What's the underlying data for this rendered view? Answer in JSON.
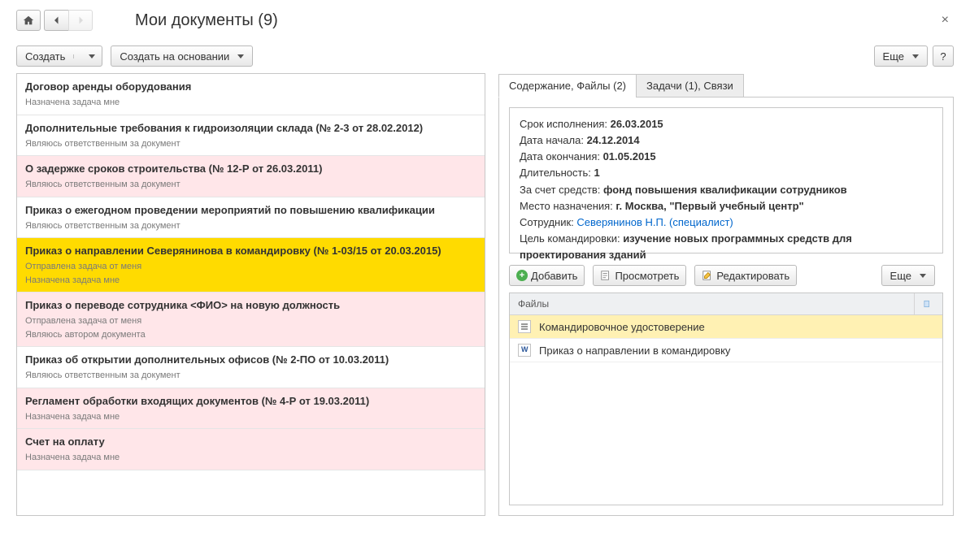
{
  "header": {
    "title": "Мои документы (9)"
  },
  "toolbar": {
    "create": "Создать",
    "create_based_on": "Создать на основании",
    "more": "Еще",
    "help": "?"
  },
  "documents": [
    {
      "title": "Договор аренды оборудования",
      "sub": "Назначена задача мне",
      "style": "white"
    },
    {
      "title": "Дополнительные требования к гидроизоляции склада (№ 2-3 от 28.02.2012)",
      "sub": "Являюсь ответственным за документ",
      "style": "white"
    },
    {
      "title": "О задержке сроков строительства (№ 12-Р от 26.03.2011)",
      "sub": "Являюсь ответственным за документ",
      "style": "pink"
    },
    {
      "title": "Приказ о ежегодном проведении мероприятий по повышению квалификации",
      "sub": "Являюсь ответственным за документ",
      "style": "white"
    },
    {
      "title": "Приказ о направлении Северянинова в командировку (№ 1-03/15 от 20.03.2015)",
      "sub": "Отправлена задача от меня\nНазначена задача мне",
      "style": "sel"
    },
    {
      "title": "Приказ о переводе сотрудника <ФИО> на новую должность",
      "sub": "Отправлена задача от меня\nЯвляюсь автором документа",
      "style": "pink"
    },
    {
      "title": "Приказ об открытии дополнительных офисов (№ 2-ПО от 10.03.2011)",
      "sub": "Являюсь ответственным за документ",
      "style": "white"
    },
    {
      "title": "Регламент обработки входящих документов (№ 4-Р от 19.03.2011)",
      "sub": "Назначена задача мне",
      "style": "pink"
    },
    {
      "title": "Счет на оплату",
      "sub": "Назначена задача мне",
      "style": "pink"
    }
  ],
  "tabs": {
    "tab1": "Содержание, Файлы (2)",
    "tab2": "Задачи (1), Связи"
  },
  "details": {
    "due_label": "Срок исполнения: ",
    "due": "26.03.2015",
    "start_label": "Дата начала: ",
    "start": "24.12.2014",
    "end_label": "Дата окончания: ",
    "end": "01.05.2015",
    "duration_label": "Длительность: ",
    "duration": "1",
    "funds_label": "За счет средств: ",
    "funds": "фонд повышения квалификации сотрудников",
    "place_label": "Место назначения: ",
    "place": "г. Москва, \"Первый учебный центр\"",
    "employee_label": "Сотрудник: ",
    "employee": "Северянинов Н.П. (специалист)",
    "purpose_label": "Цель командировки: ",
    "purpose": "изучение новых программных средств для проектирования зданий"
  },
  "file_toolbar": {
    "add": "Добавить",
    "view": "Просмотреть",
    "edit": "Редактировать",
    "more": "Еще"
  },
  "files": {
    "header": "Файлы",
    "rows": [
      {
        "name": "Командировочное удостоверение",
        "icon": "txt",
        "selected": true
      },
      {
        "name": "Приказ о направлении в командировку",
        "icon": "word",
        "selected": false
      }
    ]
  }
}
